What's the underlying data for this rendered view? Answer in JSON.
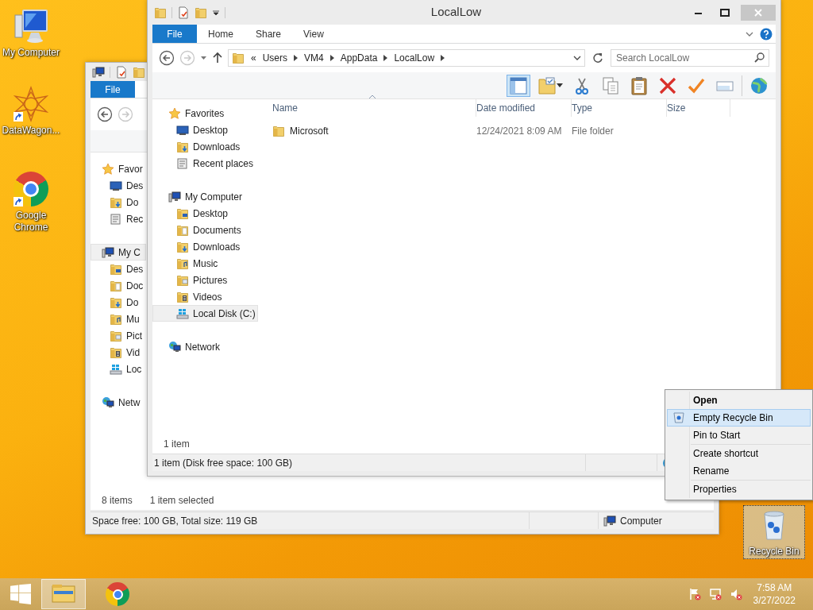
{
  "desktop": {
    "icons": [
      {
        "label": "My Computer",
        "kind": "computer",
        "shortcut": false,
        "selected": false
      },
      {
        "label": "DataWagon...",
        "kind": "app",
        "shortcut": true,
        "selected": false
      },
      {
        "label": "Google Chrome",
        "kind": "chrome",
        "shortcut": true,
        "selected": false
      },
      {
        "label": "Recycle Bin",
        "kind": "recycle",
        "shortcut": false,
        "selected": true
      }
    ]
  },
  "back_window": {
    "file_tab": "File",
    "nav": [
      {
        "label": "Favor",
        "kind": "favorites",
        "selected": false,
        "children": [
          {
            "label": "Des",
            "kind": "desktop",
            "selected": false
          },
          {
            "label": "Do",
            "kind": "downloads",
            "selected": false
          },
          {
            "label": "Rec",
            "kind": "recent",
            "selected": false
          }
        ]
      },
      {
        "label": "My C",
        "kind": "computer",
        "selected": true,
        "children": [
          {
            "label": "Des",
            "kind": "desktop_folder",
            "selected": false
          },
          {
            "label": "Doc",
            "kind": "documents",
            "selected": false
          },
          {
            "label": "Do",
            "kind": "downloads",
            "selected": false
          },
          {
            "label": "Mu",
            "kind": "music",
            "selected": false
          },
          {
            "label": "Pict",
            "kind": "pictures",
            "selected": false
          },
          {
            "label": "Vid",
            "kind": "videos",
            "selected": false
          },
          {
            "label": "Loc",
            "kind": "disk",
            "selected": false
          }
        ]
      },
      {
        "label": "Netw",
        "kind": "network",
        "selected": false
      }
    ],
    "item_count": "8 items",
    "selection_count": "1 item selected",
    "status": "Space free: 100 GB, Total size: 119 GB",
    "location": "Computer"
  },
  "front_window": {
    "title": "LocalLow",
    "file_tab": "File",
    "tabs": [
      "Home",
      "Share",
      "View"
    ],
    "address": {
      "overflow": "«",
      "crumbs": [
        "Users",
        "VM4",
        "AppData",
        "LocalLow"
      ]
    },
    "search": {
      "placeholder": "Search LocalLow"
    },
    "nav": [
      {
        "label": "Favorites",
        "kind": "favorites",
        "selected": false,
        "children": [
          {
            "label": "Desktop",
            "kind": "desktop",
            "selected": false
          },
          {
            "label": "Downloads",
            "kind": "downloads",
            "selected": false
          },
          {
            "label": "Recent places",
            "kind": "recent",
            "selected": false
          }
        ]
      },
      {
        "label": "My Computer",
        "kind": "computer",
        "selected": false,
        "children": [
          {
            "label": "Desktop",
            "kind": "desktop_folder",
            "selected": false
          },
          {
            "label": "Documents",
            "kind": "documents",
            "selected": false
          },
          {
            "label": "Downloads",
            "kind": "downloads",
            "selected": false
          },
          {
            "label": "Music",
            "kind": "music",
            "selected": false
          },
          {
            "label": "Pictures",
            "kind": "pictures",
            "selected": false
          },
          {
            "label": "Videos",
            "kind": "videos",
            "selected": false
          },
          {
            "label": "Local Disk (C:)",
            "kind": "disk",
            "selected": true
          }
        ]
      },
      {
        "label": "Network",
        "kind": "network",
        "selected": false
      }
    ],
    "columns": [
      {
        "label": "Name",
        "sorted": true
      },
      {
        "label": "Date modified",
        "sorted": false
      },
      {
        "label": "Type",
        "sorted": false
      },
      {
        "label": "Size",
        "sorted": false
      }
    ],
    "rows": [
      {
        "name": "Microsoft",
        "date_modified": "12/24/2021 8:09 AM",
        "type": "File folder"
      }
    ],
    "item_count": "1 item",
    "status": "1 item (Disk free space: 100 GB)"
  },
  "context_menu": {
    "groups": [
      [
        {
          "label": "Open",
          "default": true,
          "icon": false,
          "selected": false
        },
        {
          "label": "Empty Recycle Bin",
          "default": false,
          "icon": true,
          "selected": true
        },
        {
          "label": "Pin to Start",
          "default": false,
          "icon": false,
          "selected": false
        }
      ],
      [
        {
          "label": "Create shortcut",
          "default": false,
          "icon": false,
          "selected": false
        },
        {
          "label": "Rename",
          "default": false,
          "icon": false,
          "selected": false
        }
      ],
      [
        {
          "label": "Properties",
          "default": false,
          "icon": false,
          "selected": false
        }
      ]
    ]
  },
  "taskbar": {
    "apps": [
      {
        "kind": "explorer",
        "active": true
      },
      {
        "kind": "chrome",
        "active": false
      }
    ],
    "time": "7:58 AM",
    "date": "3/27/2022"
  }
}
